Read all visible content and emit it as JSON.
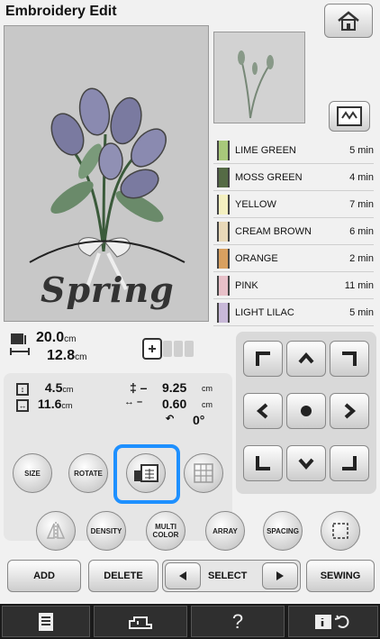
{
  "title": "Embroidery Edit",
  "design": {
    "text": "Spring"
  },
  "threads": [
    {
      "name": "LIME GREEN",
      "time": "5 min"
    },
    {
      "name": "MOSS GREEN",
      "time": "4 min"
    },
    {
      "name": "YELLOW",
      "time": "7 min"
    },
    {
      "name": "CREAM BROWN",
      "time": "6 min"
    },
    {
      "name": "ORANGE",
      "time": "2 min"
    },
    {
      "name": "PINK",
      "time": "11 min"
    },
    {
      "name": "LIGHT LILAC",
      "time": "5 min"
    }
  ],
  "size": {
    "width": "20.0",
    "height": "12.8",
    "unit": "cm"
  },
  "position": {
    "height_value": "4.5",
    "width_value": "11.6",
    "v_offset": "9.25",
    "h_offset": "0.60",
    "unit": "cm",
    "angle": "0°"
  },
  "buttons": {
    "size": "SIZE",
    "rotate": "ROTATE",
    "density": "DENSITY",
    "multi_color": "MULTI COLOR",
    "array": "ARRAY",
    "spacing": "SPACING",
    "add": "ADD",
    "delete": "DELETE",
    "select": "SELECT",
    "sewing": "SEWING"
  },
  "colors": {
    "highlight": "#1e90ff",
    "canvas": "#c8c8c8",
    "status_bar": "#1a1a1a"
  }
}
